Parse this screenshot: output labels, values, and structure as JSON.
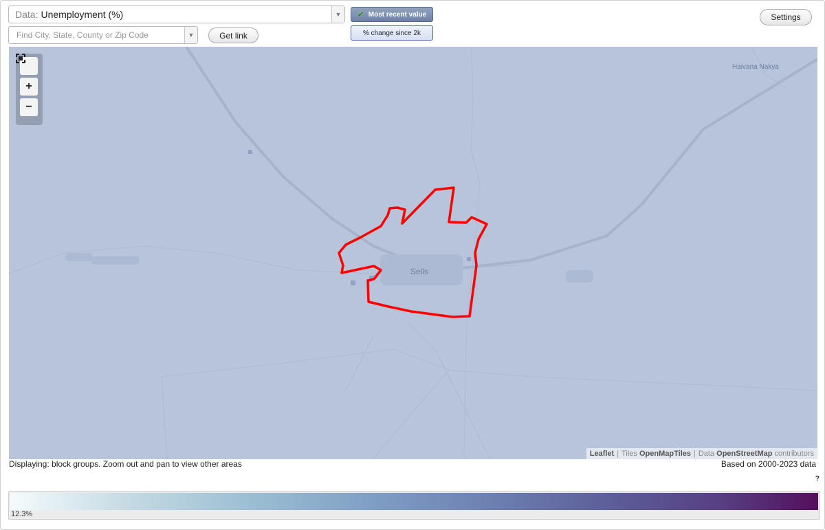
{
  "data_selector": {
    "prefix": "Data:",
    "value": "Unemployment (%)"
  },
  "search": {
    "placeholder": "Find City, State, County or Zip Code"
  },
  "buttons": {
    "get_link": "Get link",
    "settings": "Settings"
  },
  "modes": {
    "recent": "Most recent value",
    "change": "% change since 2k"
  },
  "map": {
    "places": [
      "Sells",
      "Haivana Nakya"
    ],
    "attribution": {
      "leaflet": "Leaflet",
      "tiles_prefix": "Tiles",
      "tiles": "OpenMapTiles",
      "data_prefix": "Data",
      "data": "OpenStreetMap",
      "suffix": "contributors"
    },
    "colors": {
      "background": "#b8c4da",
      "highlight": "#ff0000"
    }
  },
  "status": {
    "left": "Displaying: block groups. Zoom out and pan to view other areas",
    "right": "Based on 2000-2023 data"
  },
  "help": "?",
  "legend": {
    "min_label": "12.3%"
  }
}
